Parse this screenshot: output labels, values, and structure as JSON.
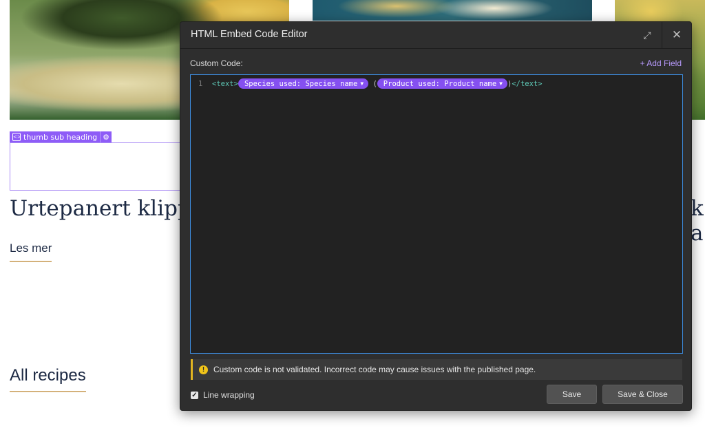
{
  "background": {
    "thumb_tag": "thumb sub heading",
    "recipe_title": "Urtepanert klippf",
    "right_title_line1": "k",
    "right_title_line2": "a",
    "read_more": "Les mer",
    "all_recipes": "All recipes"
  },
  "modal": {
    "title": "HTML Embed Code Editor",
    "custom_code_label": "Custom Code:",
    "add_field": "+ Add Field",
    "line_number": "1",
    "code": {
      "open_tag": "<text>",
      "pill1": "Species used: Species name",
      "between": " (",
      "pill2": "Product used: Product name",
      "after": ")",
      "close_tag": "</text>"
    },
    "warning_text": "Custom code is not validated. Incorrect code may cause issues with the published page.",
    "line_wrapping_label": "Line wrapping",
    "line_wrapping_checked": true,
    "save_label": "Save",
    "save_close_label": "Save & Close"
  },
  "colors": {
    "accent_purple": "#8550f0",
    "editor_focus_border": "#3d8de0",
    "warning_yellow": "#e2b521",
    "underline_gold": "#d4b17a"
  }
}
